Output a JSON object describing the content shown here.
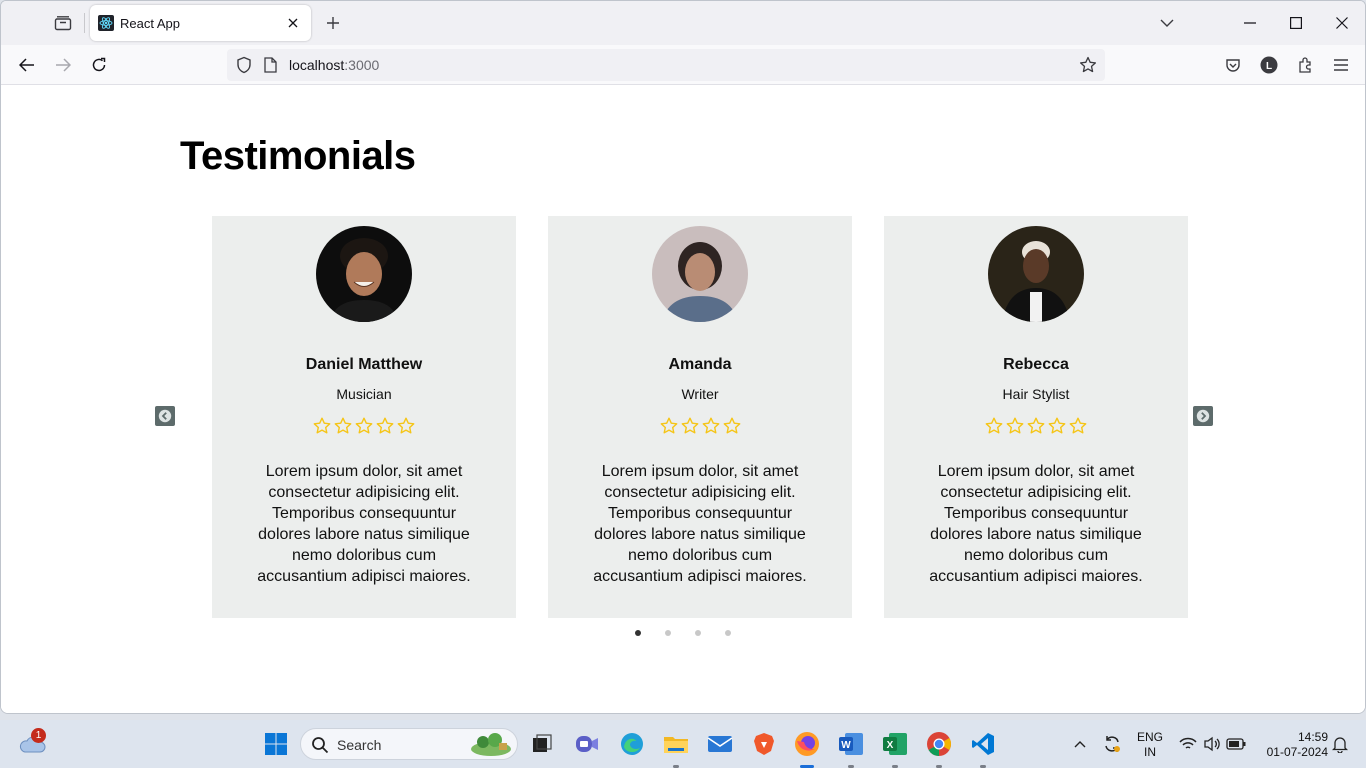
{
  "browser": {
    "tab_title": "React App",
    "url_host": "localhost",
    "url_port": ":3000"
  },
  "page": {
    "heading": "Testimonials",
    "testimonials": [
      {
        "name": "Daniel Matthew",
        "role": "Musician",
        "rating_stars": 5,
        "text": "Lorem ipsum dolor, sit amet consectetur adipisicing elit. Temporibus consequuntur dolores labore natus similique nemo doloribus cum accusantium adipisci maiores."
      },
      {
        "name": "Amanda",
        "role": "Writer",
        "rating_stars": 4,
        "text": "Lorem ipsum dolor, sit amet consectetur adipisicing elit. Temporibus consequuntur dolores labore natus similique nemo doloribus cum accusantium adipisci maiores."
      },
      {
        "name": "Rebecca",
        "role": "Hair Stylist",
        "rating_stars": 5,
        "text": "Lorem ipsum dolor, sit amet consectetur adipisicing elit. Temporibus consequuntur dolores labore natus similique nemo doloribus cum accusantium adipisci maiores."
      }
    ],
    "pagination": {
      "total": 4,
      "active": 1
    },
    "star_color": "#f5c518"
  },
  "taskbar": {
    "search_label": "Search",
    "weather_badge": "1",
    "language": "ENG",
    "region": "IN",
    "time": "14:59",
    "date": "01-07-2024"
  }
}
